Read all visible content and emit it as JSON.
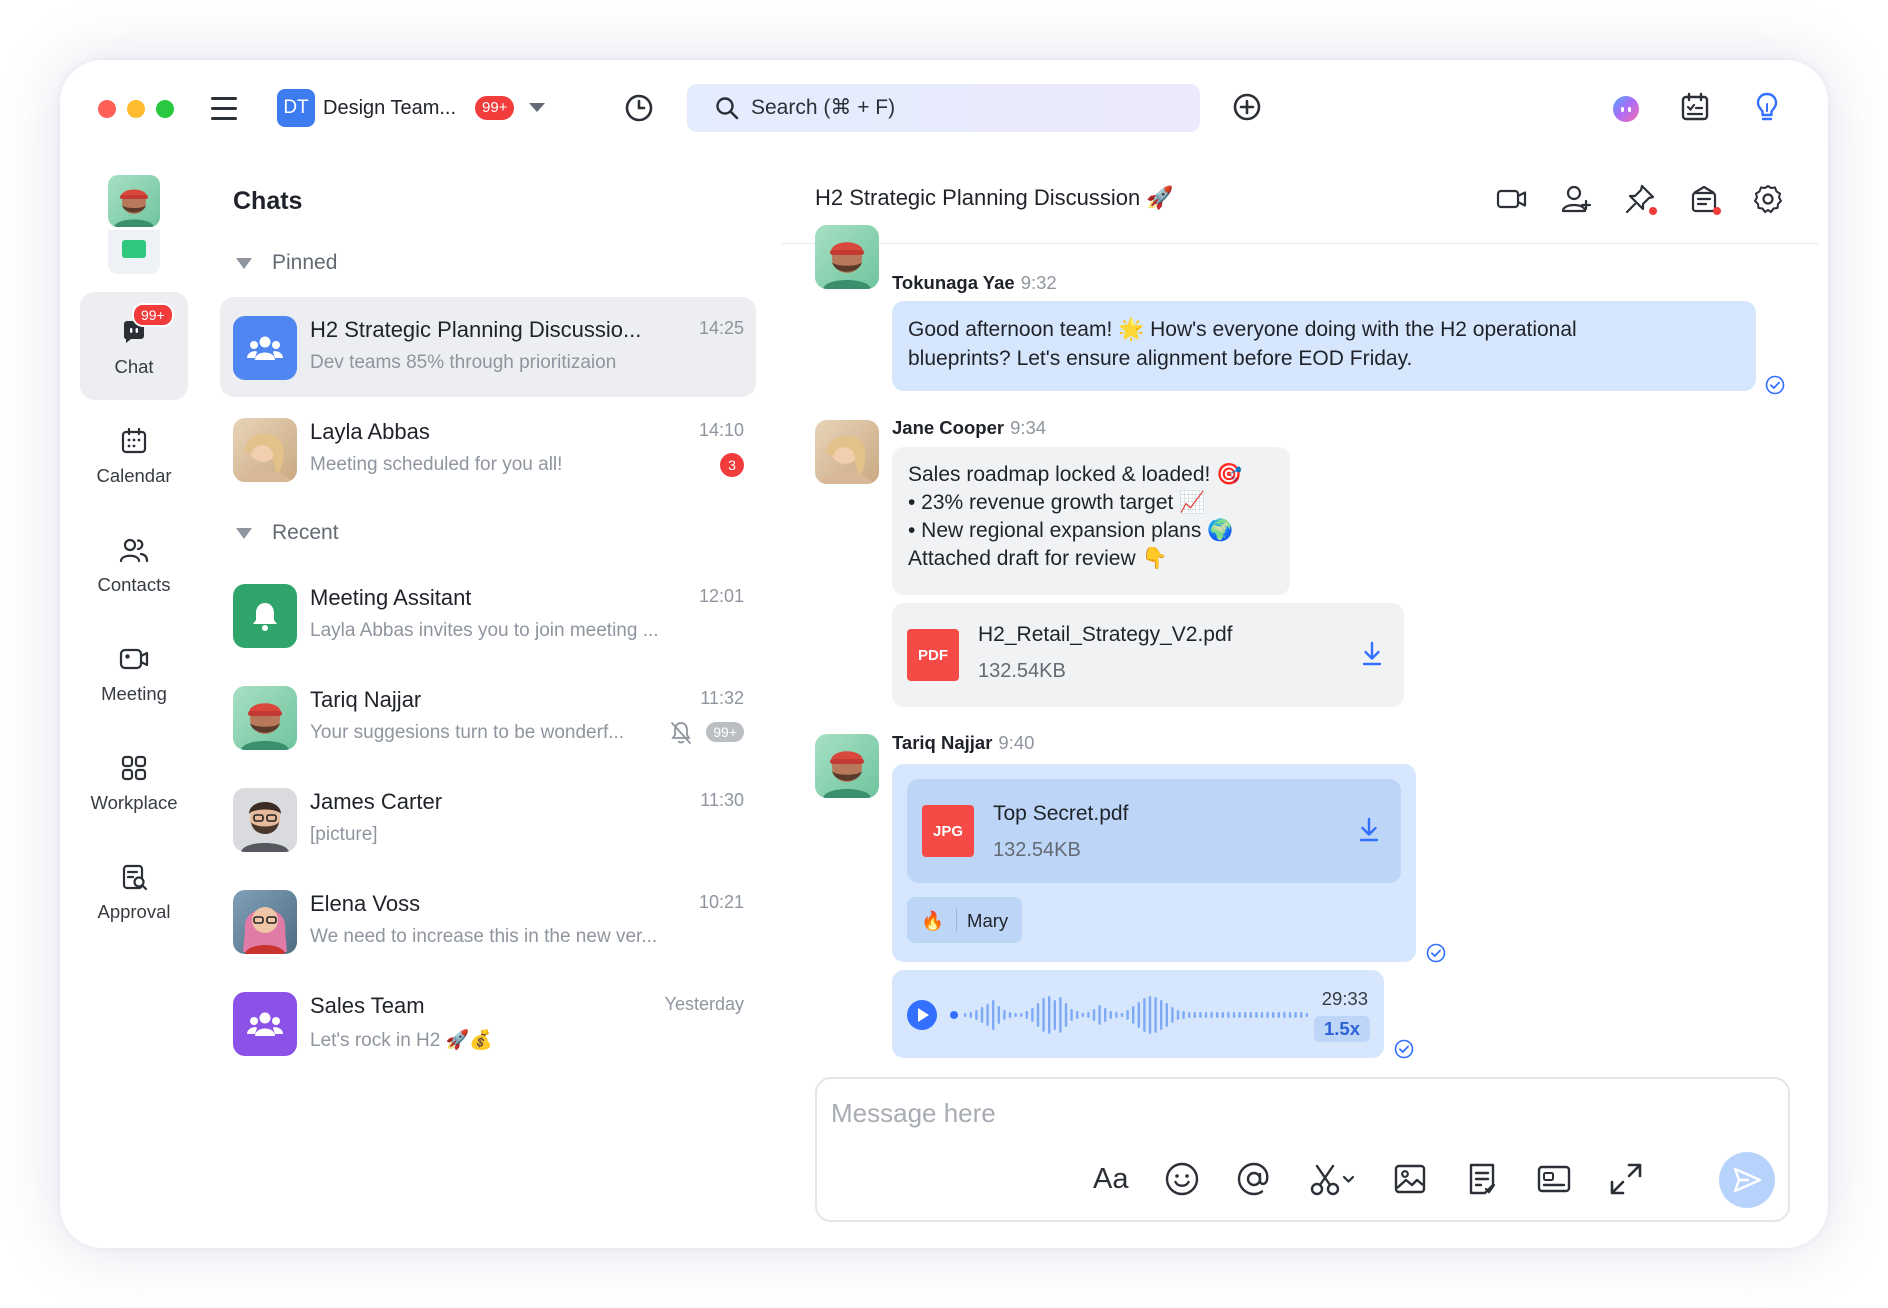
{
  "topbar": {
    "workspace_initials": "DT",
    "workspace_name": "Design Team...",
    "workspace_unread": "99+",
    "search_placeholder": "Search (⌘ + F)"
  },
  "nav": {
    "items": [
      {
        "label": "Chat",
        "badge": "99+"
      },
      {
        "label": "Calendar"
      },
      {
        "label": "Contacts"
      },
      {
        "label": "Meeting"
      },
      {
        "label": "Workplace"
      },
      {
        "label": "Approval"
      }
    ]
  },
  "chatlist": {
    "title": "Chats",
    "pinned_label": "Pinned",
    "recent_label": "Recent",
    "pinned": [
      {
        "name": "H2 Strategic Planning Discussio...",
        "preview": "Dev teams 85% through prioritizaion",
        "time": "14:25"
      },
      {
        "name": "Layla Abbas",
        "preview": "Meeting scheduled for you all!",
        "time": "14:10",
        "unread": "3"
      }
    ],
    "recent": [
      {
        "name": "Meeting Assitant",
        "preview": "Layla Abbas invites you to join meeting ...",
        "time": "12:01"
      },
      {
        "name": "Tariq Najjar",
        "preview": "Your suggesions turn to be wonderf...",
        "time": "11:32",
        "unread": "99+"
      },
      {
        "name": "James Carter",
        "preview": "[picture]",
        "time": "11:30"
      },
      {
        "name": "Elena Voss",
        "preview": "We need to increase this in the new ver...",
        "time": "10:21"
      },
      {
        "name": "Sales Team",
        "preview": "Let's rock in H2 🚀💰",
        "time": "Yesterday"
      }
    ]
  },
  "conversation": {
    "title": "H2 Strategic Planning Discussion 🚀",
    "messages": [
      {
        "sender": "Tokunaga Yae",
        "time": "9:32",
        "lines": [
          "Good afternoon team! 🌟 How's everyone doing with the H2 operational",
          "blueprints? Let's ensure alignment before EOD Friday."
        ]
      },
      {
        "sender": "Jane Cooper",
        "time": "9:34",
        "lines": [
          "Sales roadmap locked & loaded! 🎯",
          "• 23% revenue growth target 📈",
          "• New regional expansion plans 🌍",
          "Attached draft for review 👇"
        ],
        "file": {
          "type": "PDF",
          "name": "H2_Retail_Strategy_V2.pdf",
          "size": "132.54KB"
        }
      },
      {
        "sender": "Tariq Najjar",
        "time": "9:40",
        "file": {
          "type": "JPG",
          "name": "Top Secret.pdf",
          "size": "132.54KB"
        },
        "reaction": {
          "emoji": "🔥",
          "user": "Mary"
        },
        "voice": {
          "duration": "29:33",
          "speed": "1.5x"
        }
      }
    ]
  },
  "composer": {
    "placeholder": "Message here",
    "font_label": "Aa"
  },
  "colors": {
    "accent": "#3370ff",
    "badge_red": "#f23b3b",
    "bubble_mine": "#d5e6fd",
    "bubble_theirs": "#f1f2f4"
  }
}
